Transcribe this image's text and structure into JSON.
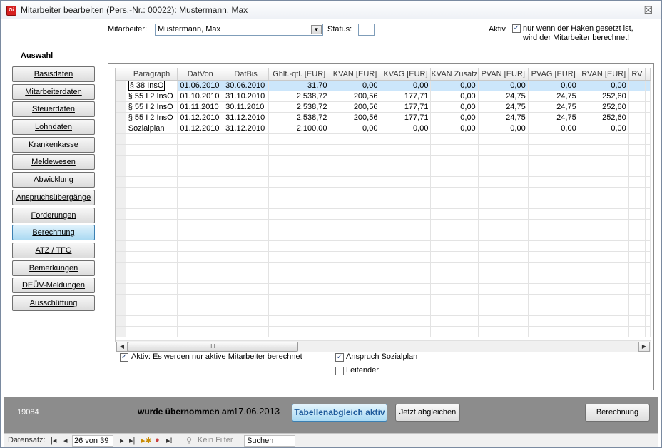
{
  "window": {
    "title": "Mitarbeiter bearbeiten (Pers.-Nr.: 00022): Mustermann, Max",
    "app_icon": "Gi",
    "close": "☒"
  },
  "header": {
    "mitarbeiter_label": "Mitarbeiter:",
    "mitarbeiter_value": "Mustermann, Max",
    "status_label": "Status:",
    "aktiv_label": "Aktiv",
    "aktiv_checked": true,
    "aktiv_hint_line1": "nur wenn der Haken gesetzt ist,",
    "aktiv_hint_line2": "wird der Mitarbeiter berechnet!"
  },
  "sidebar": {
    "title": "Auswahl",
    "items": [
      {
        "label": "Basisdaten",
        "active": false
      },
      {
        "label": "Mitarbeiterdaten",
        "active": false
      },
      {
        "label": "Steuerdaten",
        "active": false
      },
      {
        "label": "Lohndaten",
        "active": false
      },
      {
        "label": "Krankenkasse",
        "active": false
      },
      {
        "label": "Meldewesen",
        "active": false
      },
      {
        "label": "Abwicklung",
        "active": false
      },
      {
        "label": "Anspruchsübergänge",
        "active": false
      },
      {
        "label": "Forderungen",
        "active": false
      },
      {
        "label": "Berechnung",
        "active": true
      },
      {
        "label": "ATZ / TFG",
        "active": false
      },
      {
        "label": "Bemerkungen",
        "active": false
      },
      {
        "label": "DEÜV-Meldungen",
        "active": false
      },
      {
        "label": "Ausschüttung",
        "active": false
      }
    ]
  },
  "grid": {
    "columns": [
      "Paragraph",
      "DatVon",
      "DatBis",
      "Ghlt.-qtl. [EUR]",
      "KVAN [EUR]",
      "KVAG [EUR]",
      "KVAN Zusatz",
      "PVAN [EUR]",
      "PVAG [EUR]",
      "RVAN [EUR]",
      "RV"
    ],
    "rows": [
      [
        "§ 38 InsO",
        "01.06.2010",
        "30.06.2010",
        "31,70",
        "0,00",
        "0,00",
        "0,00",
        "0,00",
        "0,00",
        "0,00",
        ""
      ],
      [
        "§ 55 I 2 InsO",
        "01.10.2010",
        "31.10.2010",
        "2.538,72",
        "200,56",
        "177,71",
        "0,00",
        "24,75",
        "24,75",
        "252,60",
        ""
      ],
      [
        "§ 55 I 2 InsO",
        "01.11.2010",
        "30.11.2010",
        "2.538,72",
        "200,56",
        "177,71",
        "0,00",
        "24,75",
        "24,75",
        "252,60",
        ""
      ],
      [
        "§ 55 I 2 InsO",
        "01.12.2010",
        "31.12.2010",
        "2.538,72",
        "200,56",
        "177,71",
        "0,00",
        "24,75",
        "24,75",
        "252,60",
        ""
      ],
      [
        "Sozialplan",
        "01.12.2010",
        "31.12.2010",
        "2.100,00",
        "0,00",
        "0,00",
        "0,00",
        "0,00",
        "0,00",
        "0,00",
        ""
      ]
    ],
    "scroll_grip": "III"
  },
  "options": {
    "aktiv_label": "Aktiv: Es werden nur aktive Mitarbeiter berechnet",
    "aktiv_checked": true,
    "sozialplan_label": "Anspruch Sozialplan",
    "sozialplan_checked": true,
    "leitender_label": "Leitender",
    "leitender_checked": false
  },
  "footer": {
    "record_id": "19084",
    "message": "wurde übernommen am",
    "date": "17.06.2013",
    "tabellenabgleich_label": "Tabellenabgleich aktiv",
    "jetzt_label": "Jetzt abgleichen",
    "berechnung_label": "Berechnung"
  },
  "recordnav": {
    "label": "Datensatz:",
    "record": "26 von 39",
    "filter_label": "Kein Filter",
    "search_placeholder": "Suchen"
  }
}
